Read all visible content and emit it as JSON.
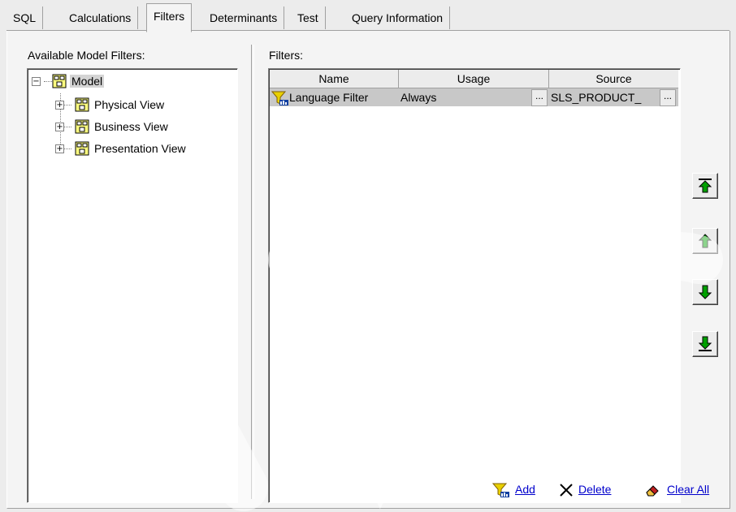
{
  "tabs": [
    {
      "label": "SQL",
      "active": false
    },
    {
      "label": "Calculations",
      "active": false
    },
    {
      "label": "Filters",
      "active": true
    },
    {
      "label": "Determinants",
      "active": false
    },
    {
      "label": "Test",
      "active": false
    },
    {
      "label": "Query Information",
      "active": false
    }
  ],
  "left_panel": {
    "title": "Available Model Filters:",
    "tree": {
      "root": {
        "label": "Model",
        "expanded": true,
        "icon": "model-folder-icon"
      },
      "children": [
        {
          "label": "Physical View",
          "icon": "model-folder-icon"
        },
        {
          "label": "Business View",
          "icon": "model-folder-icon"
        },
        {
          "label": "Presentation View",
          "icon": "model-folder-icon"
        }
      ]
    }
  },
  "right_panel": {
    "title": "Filters:",
    "columns": [
      "Name",
      "Usage",
      "Source"
    ],
    "rows": [
      {
        "name": "Language Filter",
        "usage": "Always",
        "source": "SLS_PRODUCT_",
        "icon": "filter-funnel-icon"
      }
    ],
    "ellipsis": "..."
  },
  "move_buttons": [
    {
      "name": "move-to-top-button",
      "icon": "arrow-to-top-icon"
    },
    {
      "name": "move-up-button",
      "icon": "arrow-up-icon"
    },
    {
      "name": "move-down-button",
      "icon": "arrow-down-icon"
    },
    {
      "name": "move-to-bottom-button",
      "icon": "arrow-to-bottom-icon"
    }
  ],
  "actions": {
    "add": "Add",
    "delete": "Delete",
    "clear_all": "Clear All"
  },
  "colors": {
    "link": "#0000cc",
    "arrow_green": "#00a000",
    "selection": "#c8c8c8"
  }
}
